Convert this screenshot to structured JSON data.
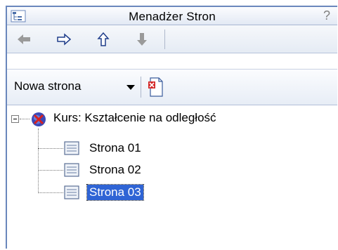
{
  "window": {
    "title": "Menadżer Stron",
    "help_symbol": "?"
  },
  "nav": {
    "buttons": [
      {
        "name": "back",
        "icon": "arrow-left-icon",
        "enabled": false
      },
      {
        "name": "forward",
        "icon": "arrow-right-icon",
        "enabled": true
      },
      {
        "name": "up",
        "icon": "arrow-up-icon",
        "enabled": true
      },
      {
        "name": "down",
        "icon": "arrow-down-icon",
        "enabled": false
      }
    ]
  },
  "toolbar": {
    "new_page_label": "Nowa strona",
    "new_page_icon": "new-document-icon"
  },
  "tree": {
    "root": {
      "label": "Kurs: Kształcenie na odległość",
      "icon": "course-globe-icon",
      "expanded": true
    },
    "pages": [
      {
        "label": "Strona 01",
        "selected": false
      },
      {
        "label": "Strona 02",
        "selected": false
      },
      {
        "label": "Strona 03",
        "selected": true
      }
    ]
  },
  "colors": {
    "selection": "#2f64d5",
    "frame": "#6a87bc"
  }
}
